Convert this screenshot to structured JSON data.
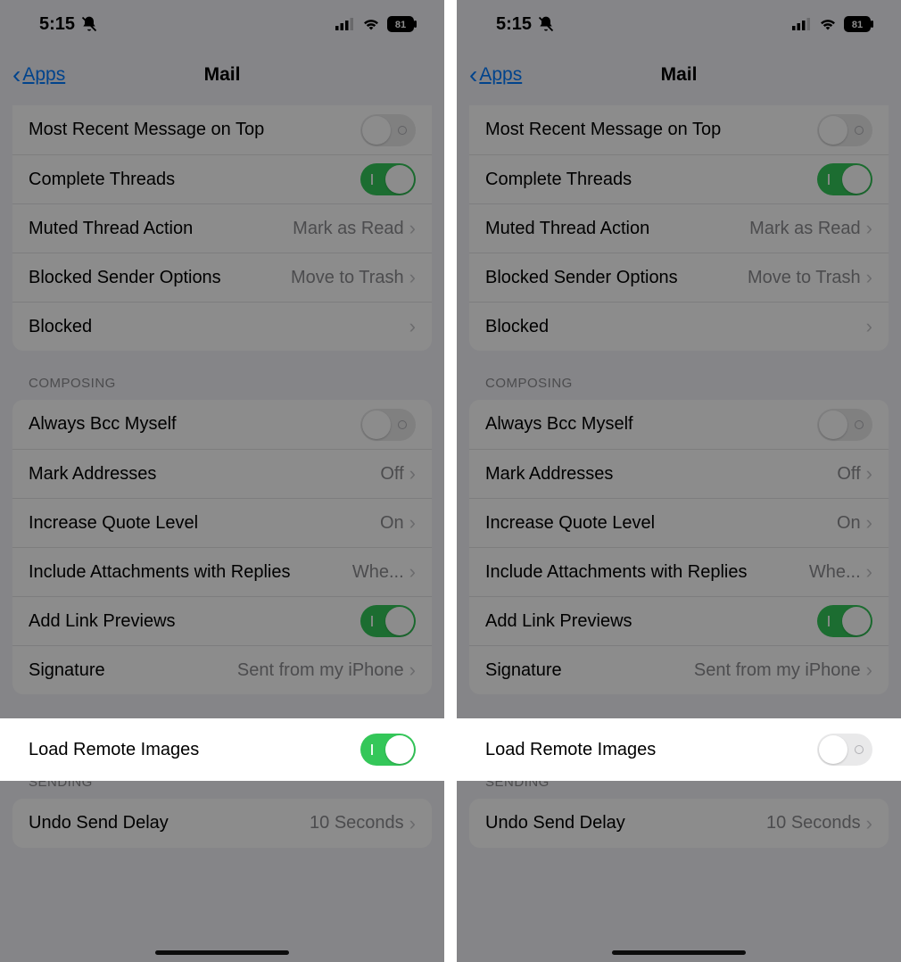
{
  "status": {
    "time": "5:15",
    "battery": "81"
  },
  "nav": {
    "back": "Apps",
    "title": "Mail"
  },
  "threading": {
    "recent": "Most Recent Message on Top",
    "complete": "Complete Threads",
    "muted": {
      "label": "Muted Thread Action",
      "value": "Mark as Read"
    },
    "blockedOpt": {
      "label": "Blocked Sender Options",
      "value": "Move to Trash"
    },
    "blocked": "Blocked"
  },
  "composing": {
    "header": "Composing",
    "bcc": "Always Bcc Myself",
    "mark": {
      "label": "Mark Addresses",
      "value": "Off"
    },
    "quote": {
      "label": "Increase Quote Level",
      "value": "On"
    },
    "attach": {
      "label": "Include Attachments with Replies",
      "value": "Whe..."
    },
    "link": "Add Link Previews",
    "sig": {
      "label": "Signature",
      "value": "Sent from my iPhone"
    }
  },
  "loadRemote": "Load Remote Images",
  "sending": {
    "header": "Sending",
    "undo": {
      "label": "Undo Send Delay",
      "value": "10 Seconds"
    }
  },
  "toggles": {
    "left": {
      "recent": false,
      "complete": true,
      "bcc": false,
      "link": true,
      "loadRemote": true
    },
    "right": {
      "recent": false,
      "complete": true,
      "bcc": false,
      "link": true,
      "loadRemote": false
    }
  },
  "highlightTop": 805
}
